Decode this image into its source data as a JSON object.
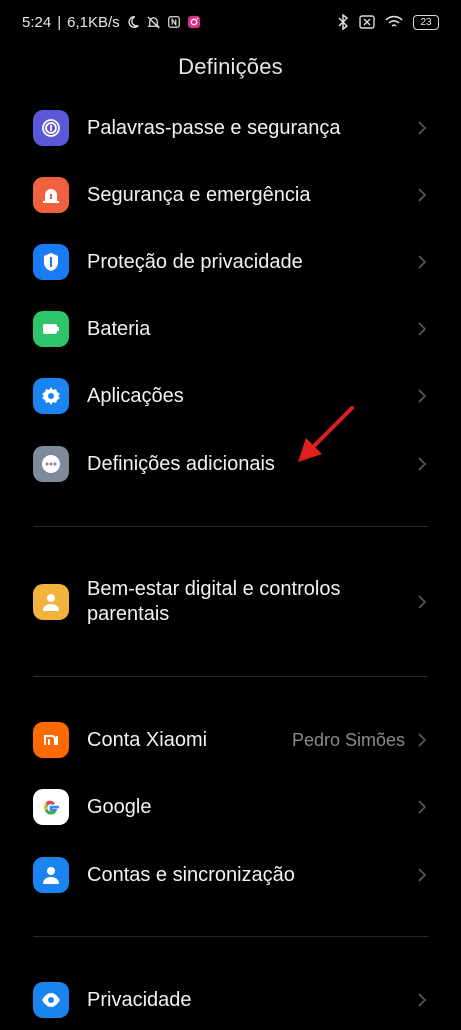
{
  "status_bar": {
    "time": "5:24",
    "network_speed": "6,1KB/s",
    "battery_level": "23",
    "left_icons": [
      "moon-icon",
      "bell-muted-icon",
      "nfc-icon",
      "instagram-icon"
    ],
    "right_icons": [
      "bluetooth-icon",
      "no-sim-icon",
      "wifi-icon",
      "battery-icon"
    ]
  },
  "header": {
    "title": "Definições"
  },
  "items": {
    "passwords": {
      "label": "Palavras-passe e segurança",
      "icon": "fingerprint-icon",
      "color": "#5b57d9"
    },
    "safety": {
      "label": "Segurança e emergência",
      "icon": "siren-icon",
      "color": "#f0623d"
    },
    "privacy_protection": {
      "label": "Proteção de privacidade",
      "icon": "shield-icon",
      "color": "#1a7cf5"
    },
    "battery": {
      "label": "Bateria",
      "icon": "battery-icon",
      "color": "#2ec46a"
    },
    "apps": {
      "label": "Aplicações",
      "icon": "gear-icon",
      "color": "#1a84f0"
    },
    "additional_settings": {
      "label": "Definições adicionais",
      "icon": "dots-icon",
      "color": "#7c8a9a"
    },
    "digital_wellbeing": {
      "label": "Bem-estar digital e controlos parentais",
      "icon": "person-heart-icon",
      "color": "#f2b43c"
    },
    "xiaomi_account": {
      "label": "Conta Xiaomi",
      "value": "Pedro Simões",
      "icon": "mi-logo-icon",
      "color": "#ff6a00"
    },
    "google": {
      "label": "Google",
      "icon": "google-g-icon",
      "color": "#ffffff"
    },
    "accounts_sync": {
      "label": "Contas e sincronização",
      "icon": "person-icon",
      "color": "#1a84f0"
    },
    "privacy": {
      "label": "Privacidade",
      "icon": "eye-icon",
      "color": "#1a84f0"
    }
  },
  "annotation": {
    "color": "#e0201e"
  }
}
